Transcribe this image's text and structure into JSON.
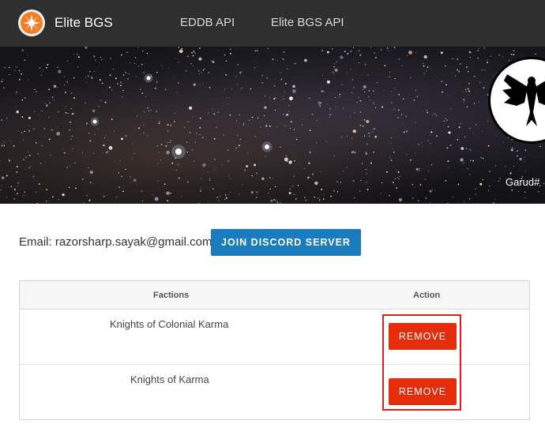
{
  "nav": {
    "brand": "Elite BGS",
    "links": [
      "EDDB API",
      "Elite BGS API"
    ]
  },
  "banner": {
    "username": "Garud#"
  },
  "profile": {
    "email_text": "Email: razorsharp.sayak@gmail.com",
    "discord_button": "JOIN DISCORD SERVER"
  },
  "table": {
    "headers": {
      "factions": "Factions",
      "action": "Action"
    },
    "rows": [
      {
        "faction": "Knights of Colonial Karma",
        "action": "REMOVE"
      },
      {
        "faction": "Knights of Karma",
        "action": "REMOVE"
      }
    ]
  },
  "colors": {
    "navbar": "#2f2f2f",
    "brand_orange": "#f57c20",
    "primary_blue": "#1a7bbd",
    "danger_red": "#e62d0b"
  }
}
